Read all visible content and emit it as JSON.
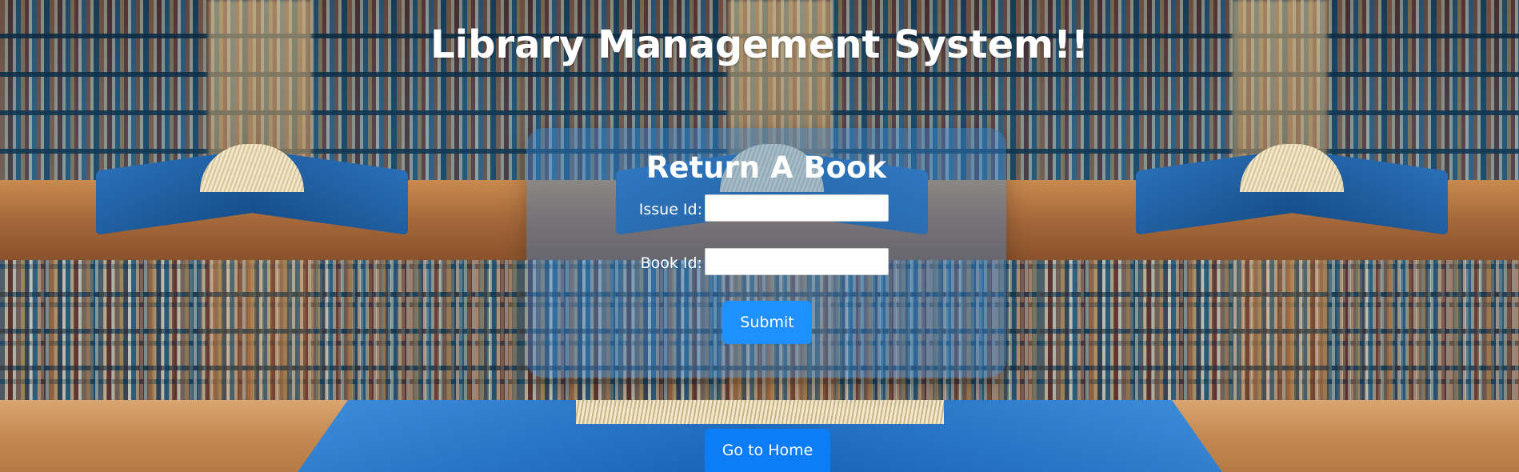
{
  "header": {
    "title": "Library Management System!!"
  },
  "form": {
    "title": "Return A Book",
    "fields": [
      {
        "label": "Issue Id:",
        "value": ""
      },
      {
        "label": "Book Id:",
        "value": ""
      }
    ],
    "submit_label": "Submit"
  },
  "footer": {
    "home_label": "Go to Home"
  }
}
